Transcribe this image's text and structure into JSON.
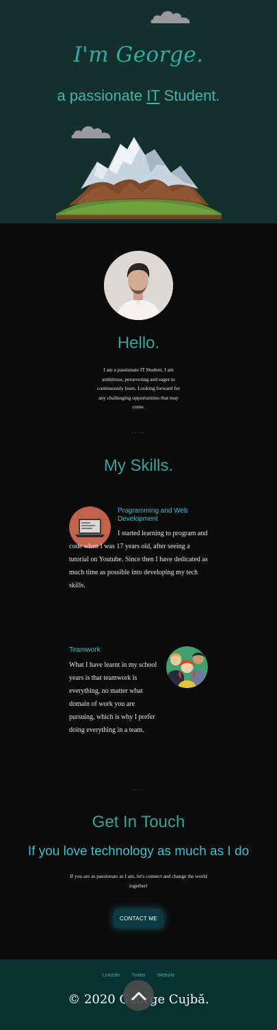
{
  "hero": {
    "title": "I'm George.",
    "subtitle_pre": "a passionate ",
    "subtitle_highlight": "IT",
    "subtitle_post": " Student."
  },
  "about": {
    "heading": "Hello.",
    "text": "I am a passionate IT Student. I am ambitious, persevering and eager to continuously learn. Looking forward for any challenging opportunities that may come."
  },
  "divider": ".....",
  "skills": {
    "heading": "My Skills.",
    "items": [
      {
        "title": "Programming and Web Development",
        "text": "I started learning to program and code when I was 17 years old, after seeing a tutorial on Youtube. Since then I have dedicated as much time as possible into developing my tech skills.",
        "icon": "laptop-icon"
      },
      {
        "title": "Teamwork",
        "text": "What I have learnt in my school years is that teamwork is everything, no matter what domain of work you are pursuing, which is why I prefer doing everything in a team.",
        "icon": "team-icon"
      }
    ]
  },
  "contact": {
    "heading": "Get In Touch",
    "tagline": "If you love technology as much as I do",
    "text": "If you are as passionate as I am, let's connect and change the world together!",
    "button": "CONTACT ME"
  },
  "footer": {
    "links": [
      "Linkedin",
      "Twitter",
      "Website"
    ],
    "copyright": "© 2020 George Cujbă."
  },
  "colors": {
    "hero_bg": "#14302c",
    "accent_teal": "#3aa29c",
    "accent_cyan": "#3fc0cf",
    "footer_bg": "#073230"
  }
}
